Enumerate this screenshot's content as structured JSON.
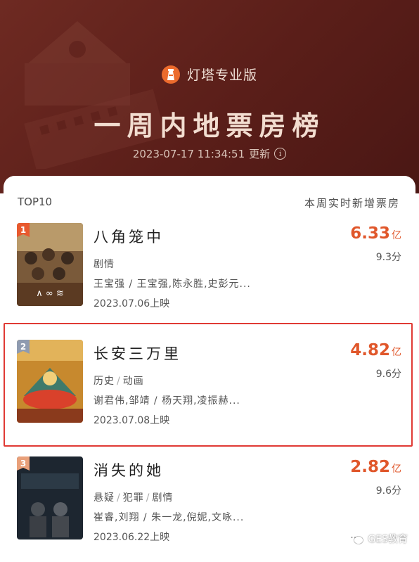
{
  "brand": {
    "name": "灯塔专业版",
    "logo_icon": "lighthouse-icon"
  },
  "title": "一周内地票房榜",
  "updated": {
    "timestamp": "2023-07-17 11:34:51",
    "suffix": "更新",
    "icon": "info-icon"
  },
  "list": {
    "left_header": "TOP10",
    "right_header": "本周实时新增票房",
    "items": [
      {
        "rank": "1",
        "title": "八角笼中",
        "genres": [
          "剧情"
        ],
        "cast": "王宝强 / 王宝强,陈永胜,史彭元...",
        "release": "2023.07.06上映",
        "box_value": "6.33",
        "box_unit": "亿",
        "score": "9.3分",
        "rank_color": "#e8592e"
      },
      {
        "rank": "2",
        "title": "长安三万里",
        "genres": [
          "历史",
          "动画"
        ],
        "cast": "谢君伟,邹靖 / 杨天翔,凌振赫...",
        "release": "2023.07.08上映",
        "box_value": "4.82",
        "box_unit": "亿",
        "score": "9.6分",
        "rank_color": "#8f9bb0"
      },
      {
        "rank": "3",
        "title": "消失的她",
        "genres": [
          "悬疑",
          "犯罪",
          "剧情"
        ],
        "cast": "崔睿,刘翔 / 朱一龙,倪妮,文咏...",
        "release": "2023.06.22上映",
        "box_value": "2.82",
        "box_unit": "亿",
        "score": "9.6分",
        "rank_color": "#e9a07a"
      }
    ]
  },
  "watermark": {
    "text": "GES教育",
    "icon": "wechat-icon"
  },
  "colors": {
    "header_bg": "#5a1e19",
    "box_office": "#e0572b",
    "highlight": "#e03a34"
  }
}
